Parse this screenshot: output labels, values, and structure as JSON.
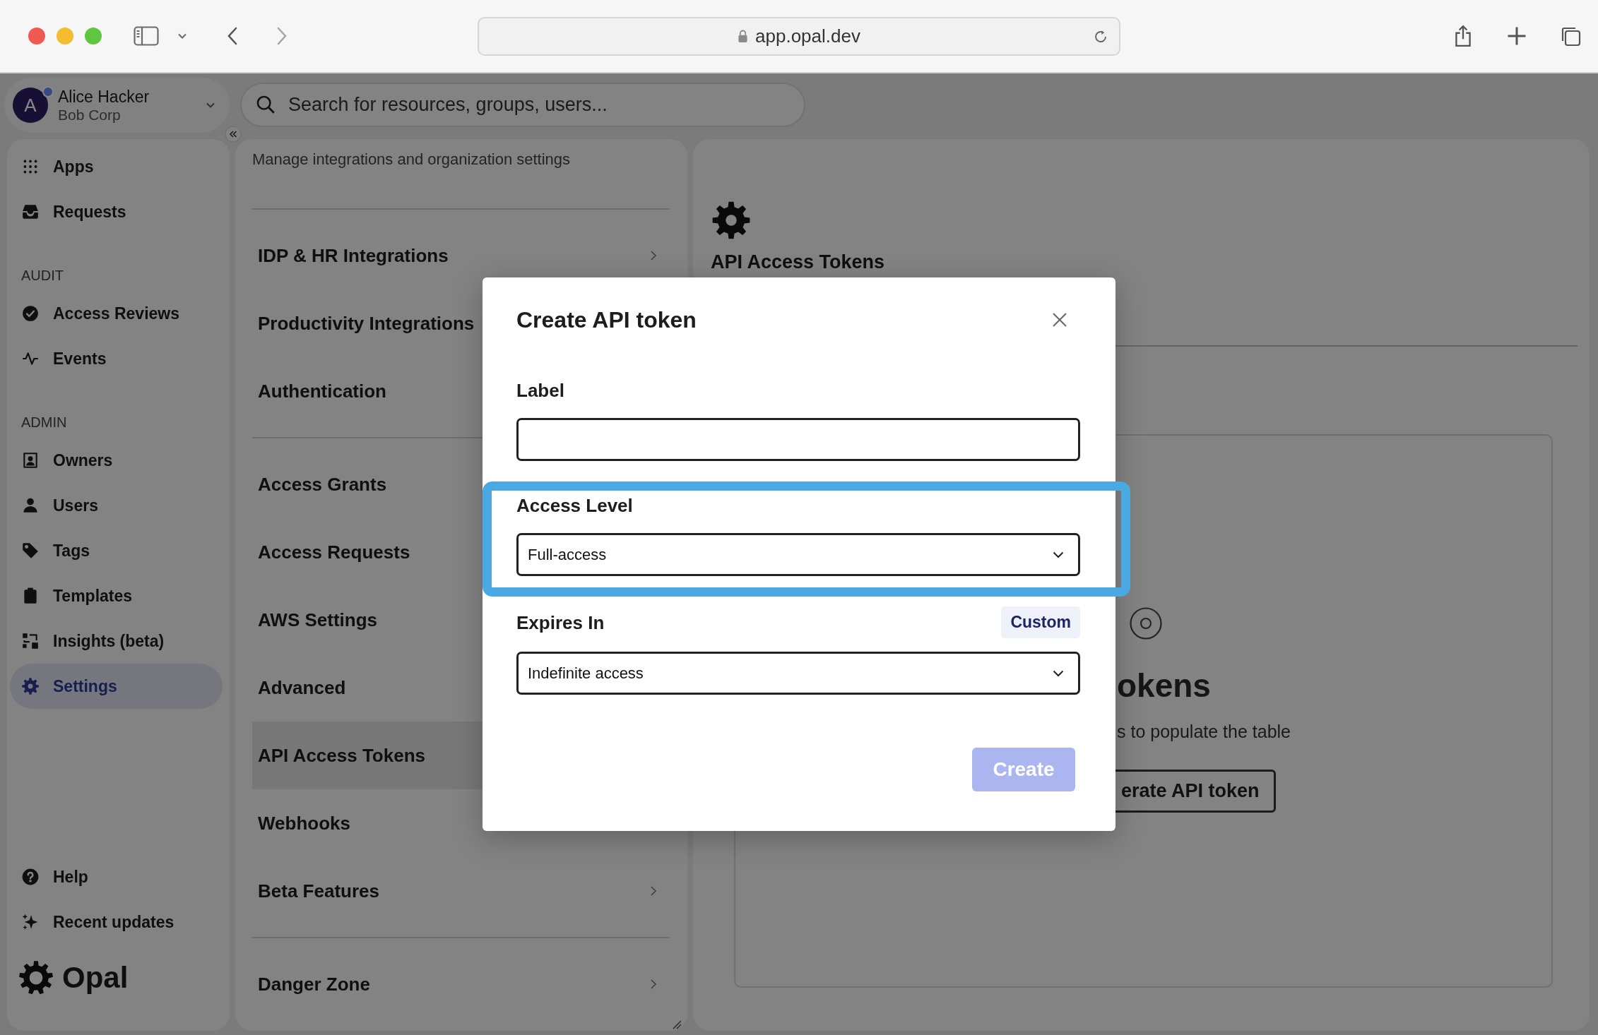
{
  "browser": {
    "url": "app.opal.dev"
  },
  "account": {
    "initial": "A",
    "name": "Alice Hacker",
    "org": "Bob Corp"
  },
  "search": {
    "placeholder": "Search for resources, groups, users..."
  },
  "sidebar": {
    "items": [
      {
        "kind": "link",
        "label": "Apps",
        "selected": false
      },
      {
        "kind": "link",
        "label": "Requests",
        "selected": false
      },
      {
        "kind": "heading",
        "label": "AUDIT"
      },
      {
        "kind": "link",
        "label": "Access Reviews",
        "selected": false
      },
      {
        "kind": "link",
        "label": "Events",
        "selected": false
      },
      {
        "kind": "heading",
        "label": "ADMIN"
      },
      {
        "kind": "link",
        "label": "Owners",
        "selected": false
      },
      {
        "kind": "link",
        "label": "Users",
        "selected": false
      },
      {
        "kind": "link",
        "label": "Tags",
        "selected": false
      },
      {
        "kind": "link",
        "label": "Templates",
        "selected": false
      },
      {
        "kind": "link",
        "label": "Insights (beta)",
        "selected": false
      },
      {
        "kind": "link",
        "label": "Settings",
        "selected": true
      }
    ],
    "footer": [
      {
        "label": "Help"
      },
      {
        "label": "Recent updates"
      }
    ],
    "logo": "Opal"
  },
  "settings": {
    "description": "Manage integrations and organization settings",
    "groups": [
      [
        {
          "label": "IDP & HR Integrations",
          "selected": false,
          "chevron": true
        },
        {
          "label": "Productivity Integrations",
          "selected": false,
          "chevron": false
        },
        {
          "label": "Authentication",
          "selected": false,
          "chevron": false
        }
      ],
      [
        {
          "label": "Access Grants",
          "selected": false,
          "chevron": false
        },
        {
          "label": "Access Requests",
          "selected": false,
          "chevron": false
        },
        {
          "label": "AWS Settings",
          "selected": false,
          "chevron": false
        },
        {
          "label": "Advanced",
          "selected": false,
          "chevron": false
        },
        {
          "label": "API Access Tokens",
          "selected": true,
          "chevron": false
        },
        {
          "label": "Webhooks",
          "selected": false,
          "chevron": false
        },
        {
          "label": "Beta Features",
          "selected": false,
          "chevron": true
        }
      ],
      [
        {
          "label": "Danger Zone",
          "selected": false,
          "chevron": true
        }
      ]
    ]
  },
  "content": {
    "title": "API Access Tokens",
    "empty_state": {
      "title": "okens",
      "text": "s to populate the table",
      "button": "erate API token"
    }
  },
  "modal": {
    "title": "Create API token",
    "fields": [
      {
        "kind": "input",
        "label": "Label",
        "highlighted": false
      },
      {
        "kind": "select",
        "label": "Access Level",
        "value": "Full-access",
        "highlighted": true
      },
      {
        "kind": "select",
        "label": "Expires In",
        "value": "Indefinite access",
        "action": "Custom",
        "highlighted": false
      }
    ],
    "submit": {
      "label": "Create",
      "disabled": true
    }
  }
}
